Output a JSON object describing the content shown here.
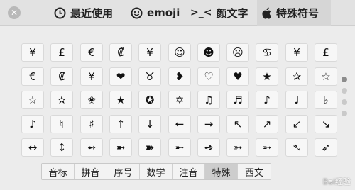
{
  "tabs": [
    {
      "icon": "clock-icon",
      "label": "最近使用",
      "active": false
    },
    {
      "icon": "smiley-icon",
      "label": "emoji",
      "active": false
    },
    {
      "icon": "kaomoji-icon",
      "glyph": ">_<",
      "label": "颜文字",
      "active": false
    },
    {
      "icon": "apple-icon",
      "label": "特殊符号",
      "active": true
    }
  ],
  "symbols": [
    [
      "¥",
      "£",
      "€",
      "₡",
      "¥",
      "☺",
      "☻",
      "☹",
      "♋",
      "¥",
      "£"
    ],
    [
      "€",
      "₡",
      "¥",
      "❤",
      "♉",
      "❥",
      "♡",
      "♥",
      "★",
      "✰",
      "☆"
    ],
    [
      "☆",
      "✫",
      "✬",
      "★",
      "✪",
      "✡",
      "♫",
      "♬",
      "♪",
      "♩",
      "♭"
    ],
    [
      "♪",
      "♮",
      "♯",
      "↑",
      "↓",
      "←",
      "→",
      "↖",
      "↗",
      "↙",
      "↘"
    ],
    [
      "↔",
      "↕",
      "➻",
      "➼",
      "➽",
      "➸",
      "➺",
      "➳",
      "➵",
      "➴",
      "➶"
    ]
  ],
  "pager": {
    "pages": 4,
    "current": 0
  },
  "categories": [
    {
      "label": "音标",
      "active": false
    },
    {
      "label": "拼音",
      "active": false
    },
    {
      "label": "序号",
      "active": false
    },
    {
      "label": "数学",
      "active": false
    },
    {
      "label": "注音",
      "active": false
    },
    {
      "label": "特殊",
      "active": true
    },
    {
      "label": "西文",
      "active": false
    }
  ],
  "watermark": "Bai经验"
}
